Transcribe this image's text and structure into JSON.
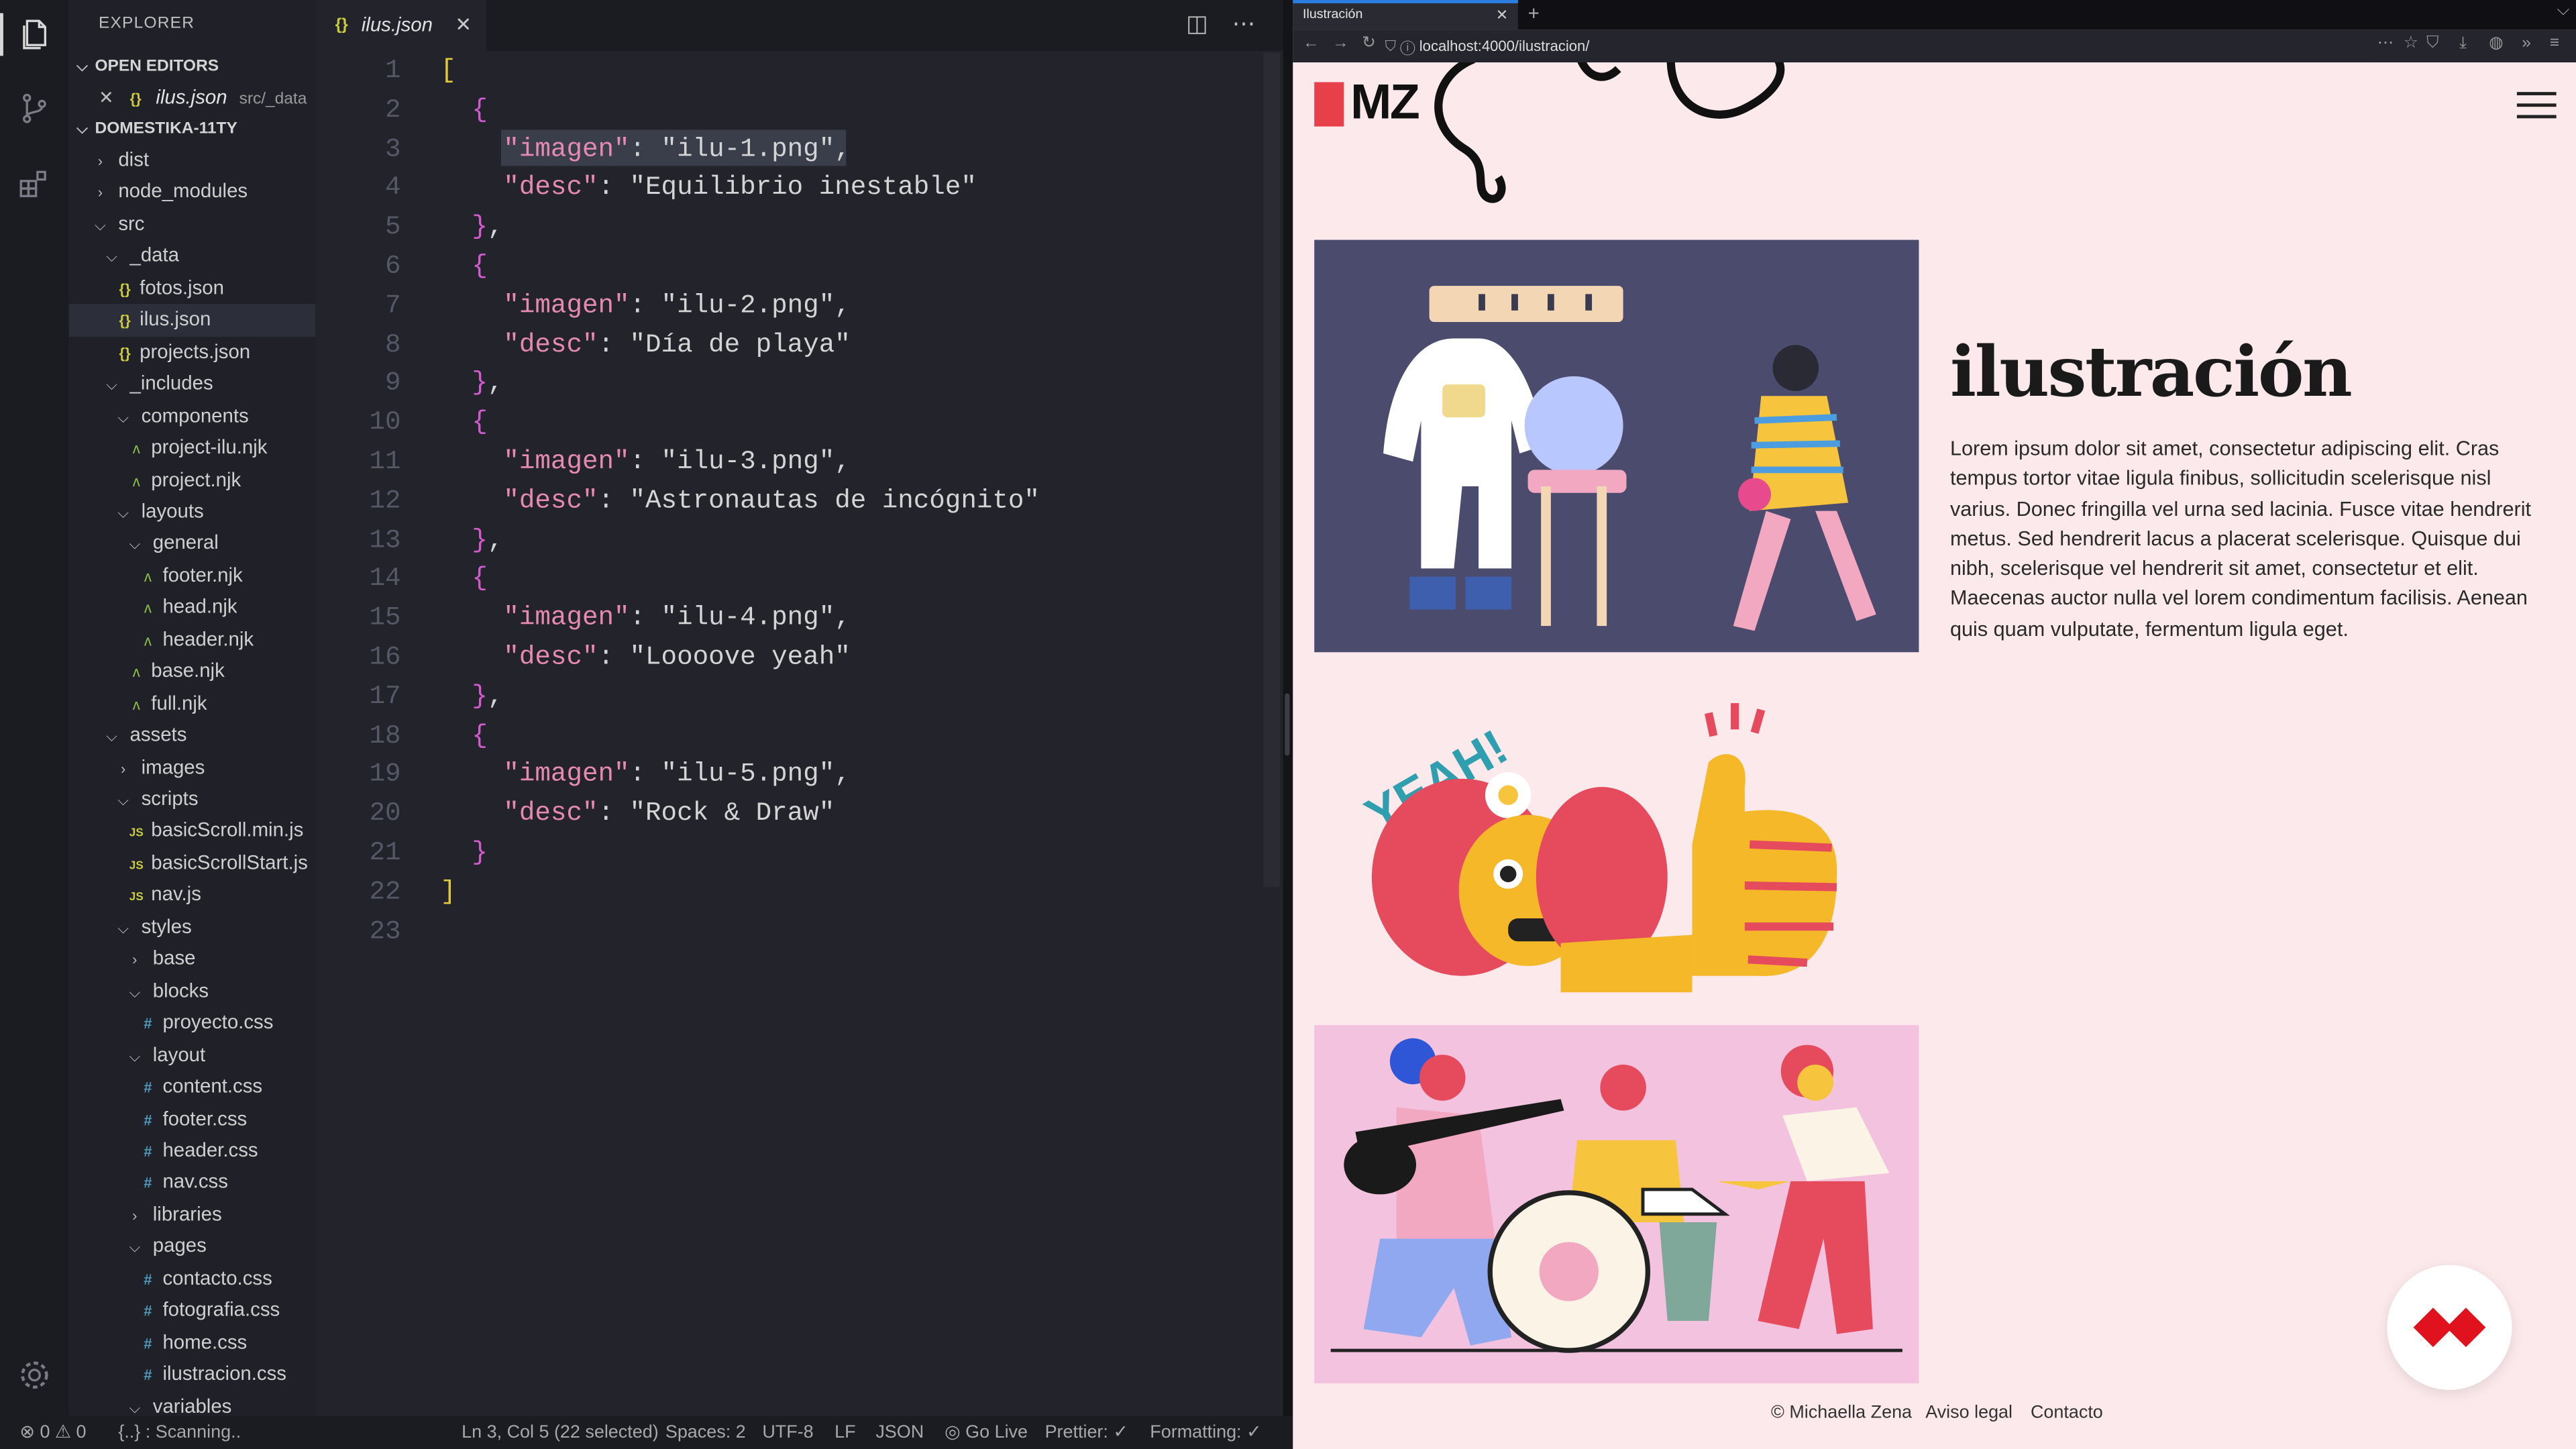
{
  "sidebar": {
    "title": "EXPLORER",
    "open_editors": {
      "header": "OPEN EDITORS",
      "file": "ilus.json",
      "path": "src/_data"
    },
    "project": "DOMESTIKA-11TY",
    "tree": [
      {
        "label": "dist",
        "kind": "folder",
        "open": false,
        "depth": 0
      },
      {
        "label": "node_modules",
        "kind": "folder",
        "open": false,
        "depth": 0
      },
      {
        "label": "src",
        "kind": "folder",
        "open": true,
        "depth": 0
      },
      {
        "label": "_data",
        "kind": "folder",
        "open": true,
        "depth": 1
      },
      {
        "label": "fotos.json",
        "kind": "json",
        "depth": 2
      },
      {
        "label": "ilus.json",
        "kind": "json",
        "depth": 2,
        "selected": true
      },
      {
        "label": "projects.json",
        "kind": "json",
        "depth": 2
      },
      {
        "label": "_includes",
        "kind": "folder",
        "open": true,
        "depth": 1
      },
      {
        "label": "components",
        "kind": "folder",
        "open": true,
        "depth": 2
      },
      {
        "label": "project-ilu.njk",
        "kind": "njk",
        "depth": 3
      },
      {
        "label": "project.njk",
        "kind": "njk",
        "depth": 3
      },
      {
        "label": "layouts",
        "kind": "folder",
        "open": true,
        "depth": 2
      },
      {
        "label": "general",
        "kind": "folder",
        "open": true,
        "depth": 3
      },
      {
        "label": "footer.njk",
        "kind": "njk",
        "depth": 4
      },
      {
        "label": "head.njk",
        "kind": "njk",
        "depth": 4
      },
      {
        "label": "header.njk",
        "kind": "njk",
        "depth": 4
      },
      {
        "label": "base.njk",
        "kind": "njk",
        "depth": 3
      },
      {
        "label": "full.njk",
        "kind": "njk",
        "depth": 3
      },
      {
        "label": "assets",
        "kind": "folder",
        "open": true,
        "depth": 1
      },
      {
        "label": "images",
        "kind": "folder",
        "open": false,
        "depth": 2
      },
      {
        "label": "scripts",
        "kind": "folder",
        "open": true,
        "depth": 2
      },
      {
        "label": "basicScroll.min.js",
        "kind": "js",
        "depth": 3
      },
      {
        "label": "basicScrollStart.js",
        "kind": "js",
        "depth": 3
      },
      {
        "label": "nav.js",
        "kind": "js",
        "depth": 3
      },
      {
        "label": "styles",
        "kind": "folder",
        "open": true,
        "depth": 2
      },
      {
        "label": "base",
        "kind": "folder",
        "open": false,
        "depth": 3
      },
      {
        "label": "blocks",
        "kind": "folder",
        "open": true,
        "depth": 3
      },
      {
        "label": "proyecto.css",
        "kind": "css",
        "depth": 4
      },
      {
        "label": "layout",
        "kind": "folder",
        "open": true,
        "depth": 3
      },
      {
        "label": "content.css",
        "kind": "css",
        "depth": 4
      },
      {
        "label": "footer.css",
        "kind": "css",
        "depth": 4
      },
      {
        "label": "header.css",
        "kind": "css",
        "depth": 4
      },
      {
        "label": "nav.css",
        "kind": "css",
        "depth": 4
      },
      {
        "label": "libraries",
        "kind": "folder",
        "open": false,
        "depth": 3
      },
      {
        "label": "pages",
        "kind": "folder",
        "open": true,
        "depth": 3
      },
      {
        "label": "contacto.css",
        "kind": "css",
        "depth": 4
      },
      {
        "label": "fotografia.css",
        "kind": "css",
        "depth": 4
      },
      {
        "label": "home.css",
        "kind": "css",
        "depth": 4
      },
      {
        "label": "ilustracion.css",
        "kind": "css",
        "depth": 4
      },
      {
        "label": "variables",
        "kind": "folder",
        "open": true,
        "depth": 3
      }
    ]
  },
  "editor": {
    "tab_label": "ilus.json",
    "lines": [
      "[",
      "  {",
      "    \"imagen\": \"ilu-1.png\",",
      "    \"desc\": \"Equilibrio inestable\"",
      "  },",
      "  {",
      "    \"imagen\": \"ilu-2.png\",",
      "    \"desc\": \"Día de playa\"",
      "  },",
      "  {",
      "    \"imagen\": \"ilu-3.png\",",
      "    \"desc\": \"Astronautas de incógnito\"",
      "  },",
      "  {",
      "    \"imagen\": \"ilu-4.png\",",
      "    \"desc\": \"Loooove yeah\"",
      "  },",
      "  {",
      "    \"imagen\": \"ilu-5.png\",",
      "    \"desc\": \"Rock & Draw\"",
      "  }",
      "]",
      ""
    ]
  },
  "status": {
    "problems": "⊗ 0 ⚠ 0",
    "scanning": "{..} : Scanning..",
    "cursor": "Ln 3, Col 5 (22 selected)",
    "spaces": "Spaces: 2",
    "encoding": "UTF-8",
    "eol": "LF",
    "language": "JSON",
    "golive": "Go Live",
    "prettier": "Prettier: ✓",
    "formatting": "Formatting: ✓"
  },
  "browser": {
    "tab_title": "Ilustración",
    "url": "localhost:4000/ilustracion/",
    "logo": "MZ",
    "page_title": "ilustración",
    "body": "Lorem ipsum dolor sit amet, consectetur adipiscing elit. Cras tempus tortor vitae ligula finibus, sollicitudin scelerisque nisl varius. Donec fringilla vel urna sed lacinia. Fusce vitae hendrerit metus. Sed hendrerit lacus a placerat scelerisque. Quisque dui nibh, scelerisque vel hendrerit sit amet, consectetur et elit. Maecenas auctor nulla vel lorem condimentum facilisis. Aenean quis quam vulputate, fermentum ligula eget.",
    "yeah_text": "YEAH!",
    "footer": {
      "copyright": "© Michaella Zena",
      "legal": "Aviso legal",
      "contact": "Contacto"
    }
  },
  "colors": {
    "accent_red": "#e8404b",
    "page_bg": "#fbe9ec",
    "editor_bg": "#22232b"
  }
}
